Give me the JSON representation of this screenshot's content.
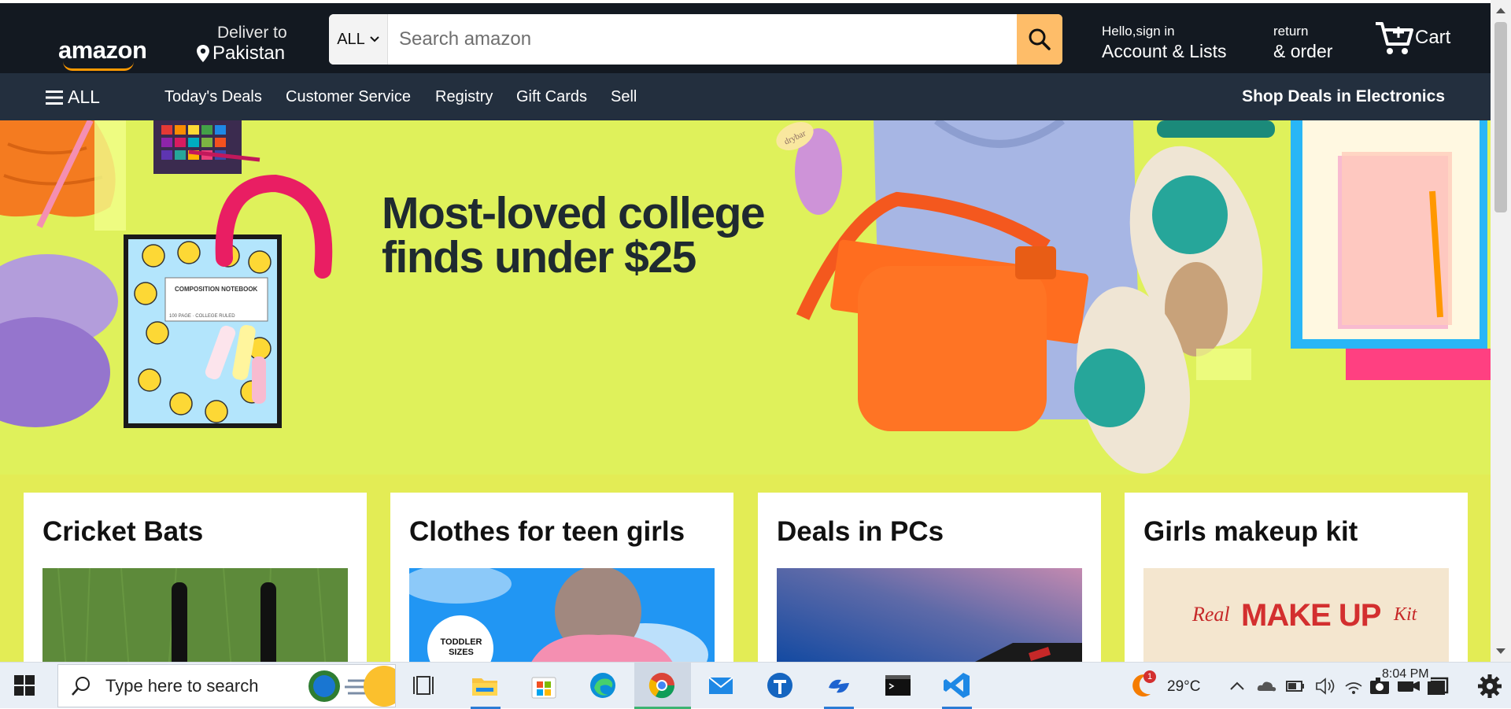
{
  "header": {
    "logo": "amazon",
    "deliver_to": "Deliver to",
    "location": "Pakistan",
    "search_category": "ALL",
    "search_placeholder": "Search amazon",
    "account_greeting": "Hello,sign in",
    "account_label": "Account & Lists",
    "returns_line1": "return",
    "returns_line2": "& order",
    "cart_label": "Cart"
  },
  "nav": {
    "all_label": "ALL",
    "links": [
      "Today's Deals",
      "Customer Service",
      "Registry",
      "Gift Cards",
      "Sell"
    ],
    "right_label": "Shop Deals in Electronics"
  },
  "hero": {
    "title_line1": "Most-loved college",
    "title_line2": "finds under $25",
    "notebook_label": "COMPOSITION NOTEBOOK",
    "notebook_sub": "100 PAGE · COLLEGE RULED",
    "comb_brand": "drybar"
  },
  "cards": [
    {
      "title": "Cricket Bats"
    },
    {
      "title": "Clothes for teen girls",
      "badge": "TODDLER SIZES"
    },
    {
      "title": "Deals in PCs"
    },
    {
      "title": "Girls makeup kit",
      "img_text_1": "Real",
      "img_text_2": "MAKE UP",
      "img_text_3": "Kit"
    }
  ],
  "taskbar": {
    "search_placeholder": "Type here to search",
    "weather_badge": "1",
    "temperature": "29°C",
    "time": "8:04 PM"
  },
  "colors": {
    "header_bg": "#131921",
    "nav_bg": "#232f3e",
    "search_button": "#febd69",
    "hero_bg": "#dff15b",
    "page_bg": "#e3ec55"
  }
}
